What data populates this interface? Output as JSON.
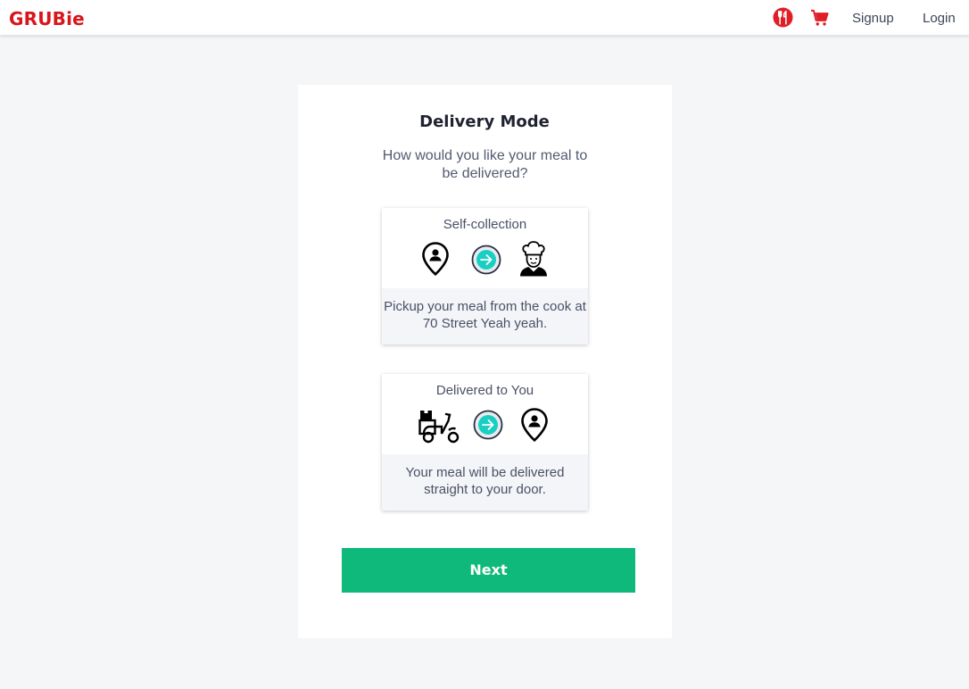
{
  "app": {
    "name": "GRUBie",
    "brand_color": "#d9151c"
  },
  "nav": {
    "food_icon": "fork-knife-icon",
    "cart_icon": "cart-icon",
    "signup_label": "Signup",
    "login_label": "Login"
  },
  "main": {
    "title": "Delivery Mode",
    "question": "How would you like your meal to be delivered?",
    "options": [
      {
        "title": "Self-collection",
        "icons": [
          "location-pin-icon",
          "arrow-right-icon",
          "chef-icon"
        ],
        "description": "Pickup your meal from the cook at 70 Street Yeah yeah."
      },
      {
        "title": "Delivered to You",
        "icons": [
          "delivery-scooter-icon",
          "arrow-right-icon",
          "location-pin-icon"
        ],
        "description": "Your meal will be delivered straight to your door."
      }
    ],
    "next_label": "Next",
    "accent_color": "#0fb97b"
  }
}
